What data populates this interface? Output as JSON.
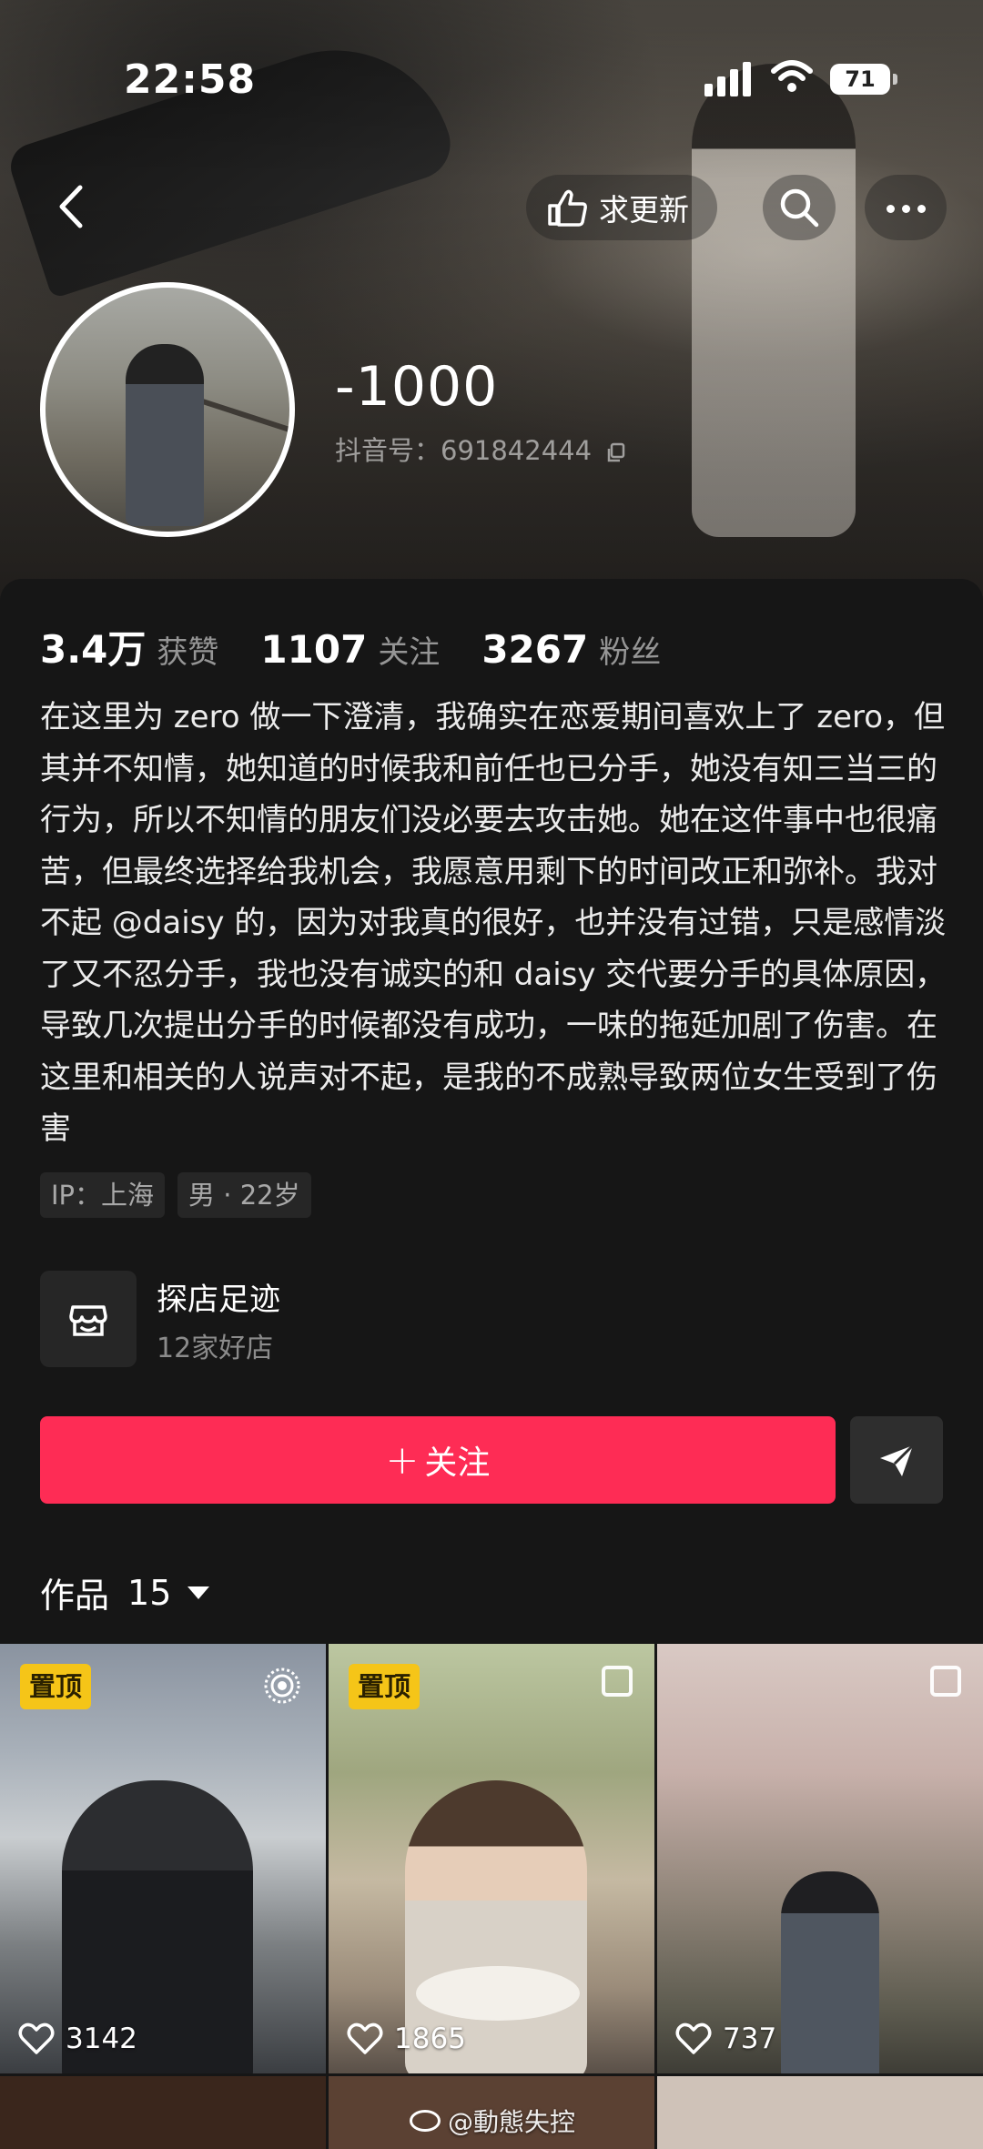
{
  "status_bar": {
    "time": "22:58",
    "battery": "71"
  },
  "header": {
    "request_update_label": "求更新"
  },
  "profile": {
    "nickname": "-1000",
    "douyin_id": "抖音号：691842444"
  },
  "stats": [
    {
      "value": "3.4万",
      "label": "获赞"
    },
    {
      "value": "1107",
      "label": "关注"
    },
    {
      "value": "3267",
      "label": "粉丝"
    }
  ],
  "bio": "在这里为 zero 做一下澄清，我确实在恋爱期间喜欢上了 zero，但其并不知情，她知道的时候我和前任也已分手，她没有知三当三的行为，所以不知情的朋友们没必要去攻击她。她在这件事中也很痛苦，但最终选择给我机会，我愿意用剩下的时间改正和弥补。我对不起 @daisy 的，因为对我真的很好，也并没有过错，只是感情淡了又不忍分手，我也没有诚实的和 daisy 交代要分手的具体原因，导致几次提出分手的时候都没有成功，一味的拖延加剧了伤害。在这里和相关的人说声对不起，是我的不成熟导致两位女生受到了伤害",
  "tags": [
    "IP：上海",
    "男 · 22岁"
  ],
  "shop": {
    "title": "探店足迹",
    "subtitle": "12家好店"
  },
  "actions": {
    "follow_label": "关注"
  },
  "works": {
    "label": "作品",
    "count": "15"
  },
  "videos": [
    {
      "pinned_label": "置顶",
      "likes": "3142"
    },
    {
      "pinned_label": "置顶",
      "likes": "1865"
    },
    {
      "likes": "737"
    }
  ],
  "watermark": "@動態失控",
  "colors": {
    "accent": "#fe2c55",
    "pin": "#f5c518",
    "background": "#161616"
  }
}
